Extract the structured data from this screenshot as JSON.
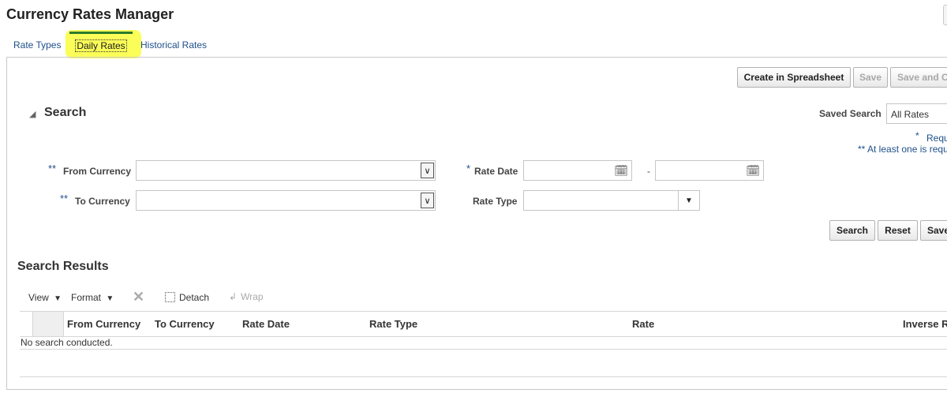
{
  "page": {
    "title": "Currency Rates Manager"
  },
  "tabs": [
    {
      "label": "Rate Types"
    },
    {
      "label": "Daily Rates"
    },
    {
      "label": "Historical Rates"
    }
  ],
  "toolbar": {
    "create_spreadsheet": "Create in Spreadsheet",
    "save": "Save",
    "save_close": "Save and C"
  },
  "search": {
    "title": "Search",
    "saved_search_label": "Saved Search",
    "saved_search_value": "All Rates",
    "required_note": "Requ",
    "required_marker": "*",
    "atleast_note": "** At least one is requ",
    "fields": {
      "from_currency": {
        "marker": "**",
        "label": "From Currency",
        "value": ""
      },
      "to_currency": {
        "marker": "**",
        "label": "To Currency",
        "value": ""
      },
      "rate_date": {
        "marker": "*",
        "label": "Rate Date",
        "from": "",
        "separator": "-",
        "to": ""
      },
      "rate_type": {
        "label": "Rate Type",
        "value": ""
      }
    },
    "buttons": {
      "search": "Search",
      "reset": "Reset",
      "save": "Save"
    }
  },
  "results": {
    "title": "Search Results",
    "toolbar": {
      "view": "View",
      "format": "Format",
      "detach": "Detach",
      "wrap": "Wrap"
    },
    "columns": [
      "From Currency",
      "To Currency",
      "Rate Date",
      "Rate Type",
      "Rate",
      "Inverse R"
    ],
    "empty_message": "No search conducted."
  }
}
